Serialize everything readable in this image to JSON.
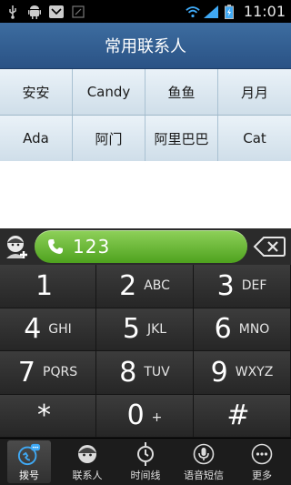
{
  "status_bar": {
    "time": "11:01",
    "icons": [
      "usb-icon",
      "android-icon",
      "missed-call-icon",
      "notification-icon",
      "wifi-icon",
      "signal-icon",
      "battery-charging-icon"
    ]
  },
  "header": {
    "title": "常用联系人"
  },
  "favorites": [
    {
      "name": "安安"
    },
    {
      "name": "Candy"
    },
    {
      "name": "鱼鱼"
    },
    {
      "name": "月月"
    },
    {
      "name": "Ada"
    },
    {
      "name": "阿门"
    },
    {
      "name": "阿里巴巴"
    },
    {
      "name": "Cat"
    }
  ],
  "dialer": {
    "number": "123"
  },
  "keypad": [
    {
      "digit": "1",
      "letters": ""
    },
    {
      "digit": "2",
      "letters": "ABC"
    },
    {
      "digit": "3",
      "letters": "DEF"
    },
    {
      "digit": "4",
      "letters": "GHI"
    },
    {
      "digit": "5",
      "letters": "JKL"
    },
    {
      "digit": "6",
      "letters": "MNO"
    },
    {
      "digit": "7",
      "letters": "PQRS"
    },
    {
      "digit": "8",
      "letters": "TUV"
    },
    {
      "digit": "9",
      "letters": "WXYZ"
    },
    {
      "digit": "*",
      "letters": ""
    },
    {
      "digit": "0",
      "letters": "+"
    },
    {
      "digit": "#",
      "letters": ""
    }
  ],
  "bottom_nav": [
    {
      "label": "拨号",
      "icon": "dialpad-chat-icon",
      "active": true
    },
    {
      "label": "联系人",
      "icon": "contact-face-icon",
      "active": false
    },
    {
      "label": "时间线",
      "icon": "timeline-clock-icon",
      "active": false
    },
    {
      "label": "语音短信",
      "icon": "microphone-icon",
      "active": false
    },
    {
      "label": "更多",
      "icon": "more-dots-icon",
      "active": false
    }
  ],
  "colors": {
    "title_bar": "#2f5b8f",
    "call_green": "#5cb22a",
    "keypad_bg": "#2e2e2e"
  }
}
